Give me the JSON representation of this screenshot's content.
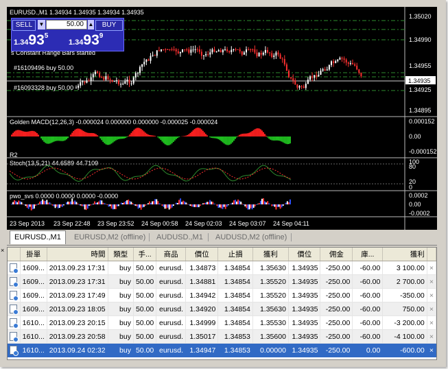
{
  "chart": {
    "title": "EURUSD.,M1  1.34934 1.34935 1.34934 1.34935",
    "trade_panel": {
      "sell": "SELL",
      "buy": "BUY",
      "lot": "50.00",
      "bid_main": "1.34",
      "bid_big": "93",
      "bid_sup": "5",
      "ask_main": "1.34",
      "ask_big": "93",
      "ask_sup": "9"
    },
    "msg_bars": "s Constant Range Bars started",
    "order_label_1": "#16109496 buy 50.00",
    "order_label_2": "#16093328 buy 50.00",
    "price_axis": [
      "1.35020",
      "1.34990",
      "1.34955",
      "1.34935",
      "1.34925",
      "1.34895"
    ],
    "macd_label": "Golden MACD(12,26,3) -0.000024 0.000000 0.000000 -0.000025 -0.000024",
    "macd_axis": [
      "0.000152",
      "0.00",
      "-0.000152"
    ],
    "macd_extra": "R2",
    "stoch_label": "Stoch(13,5,21) 44.6589 44.7109",
    "stoch_axis": [
      "100",
      "80",
      "20",
      "0"
    ],
    "pwo_label": "pwo_svs 0.0000 0.0000 0.0000 -0.0000",
    "pwo_axis": [
      "0.0002",
      "0.00",
      "-0.0002"
    ],
    "time_axis": [
      "23 Sep 2013",
      "23 Sep 22:48",
      "23 Sep 23:52",
      "24 Sep 00:58",
      "24 Sep 02:03",
      "24 Sep 03:07",
      "24 Sep 04:11"
    ],
    "colors": {
      "bull": "#ffffff",
      "bear": "#ff3030",
      "level": "#2e8b2e",
      "macd_up": "#20c020",
      "macd_dn": "#ff2020"
    }
  },
  "tabs": [
    "EURUSD.,M1",
    "EURUSD,M2 (offline)",
    "AUDUSD.,M1",
    "AUDUSD,M2 (offline)"
  ],
  "table": {
    "headers": [
      "",
      "掛單",
      "時間",
      "類型",
      "手...",
      "商品",
      "價位",
      "止損",
      "獲利",
      "價位",
      "佣金",
      "庫...",
      "獲利",
      ""
    ],
    "rows": [
      [
        "1609...",
        "2013.09.23 17:31",
        "buy",
        "50.00",
        "eurusd.",
        "1.34873",
        "1.34854",
        "1.35630",
        "1.34935",
        "-250.00",
        "-60.00",
        "3 100.00",
        "×"
      ],
      [
        "1609...",
        "2013.09.23 17:31",
        "buy",
        "50.00",
        "eurusd.",
        "1.34881",
        "1.34854",
        "1.35520",
        "1.34935",
        "-250.00",
        "-60.00",
        "2 700.00",
        "×"
      ],
      [
        "1609...",
        "2013.09.23 17:49",
        "buy",
        "50.00",
        "eurusd.",
        "1.34942",
        "1.34854",
        "1.35520",
        "1.34935",
        "-250.00",
        "-60.00",
        "-350.00",
        "×"
      ],
      [
        "1609...",
        "2013.09.23 18:05",
        "buy",
        "50.00",
        "eurusd.",
        "1.34920",
        "1.34854",
        "1.35630",
        "1.34935",
        "-250.00",
        "-60.00",
        "750.00",
        "×"
      ],
      [
        "1610...",
        "2013.09.23 20:15",
        "buy",
        "50.00",
        "eurusd.",
        "1.34999",
        "1.34854",
        "1.35530",
        "1.34935",
        "-250.00",
        "-60.00",
        "-3 200.00",
        "×"
      ],
      [
        "1610...",
        "2013.09.23 20:58",
        "buy",
        "50.00",
        "eurusd.",
        "1.35017",
        "1.34853",
        "1.35600",
        "1.34935",
        "-250.00",
        "-60.00",
        "-4 100.00",
        "×"
      ],
      [
        "1610...",
        "2013.09.24 02:32",
        "buy",
        "50.00",
        "eurusd.",
        "1.34947",
        "1.34853",
        "0.00000",
        "1.34935",
        "-250.00",
        "0.00",
        "-600.00",
        "×"
      ]
    ]
  }
}
